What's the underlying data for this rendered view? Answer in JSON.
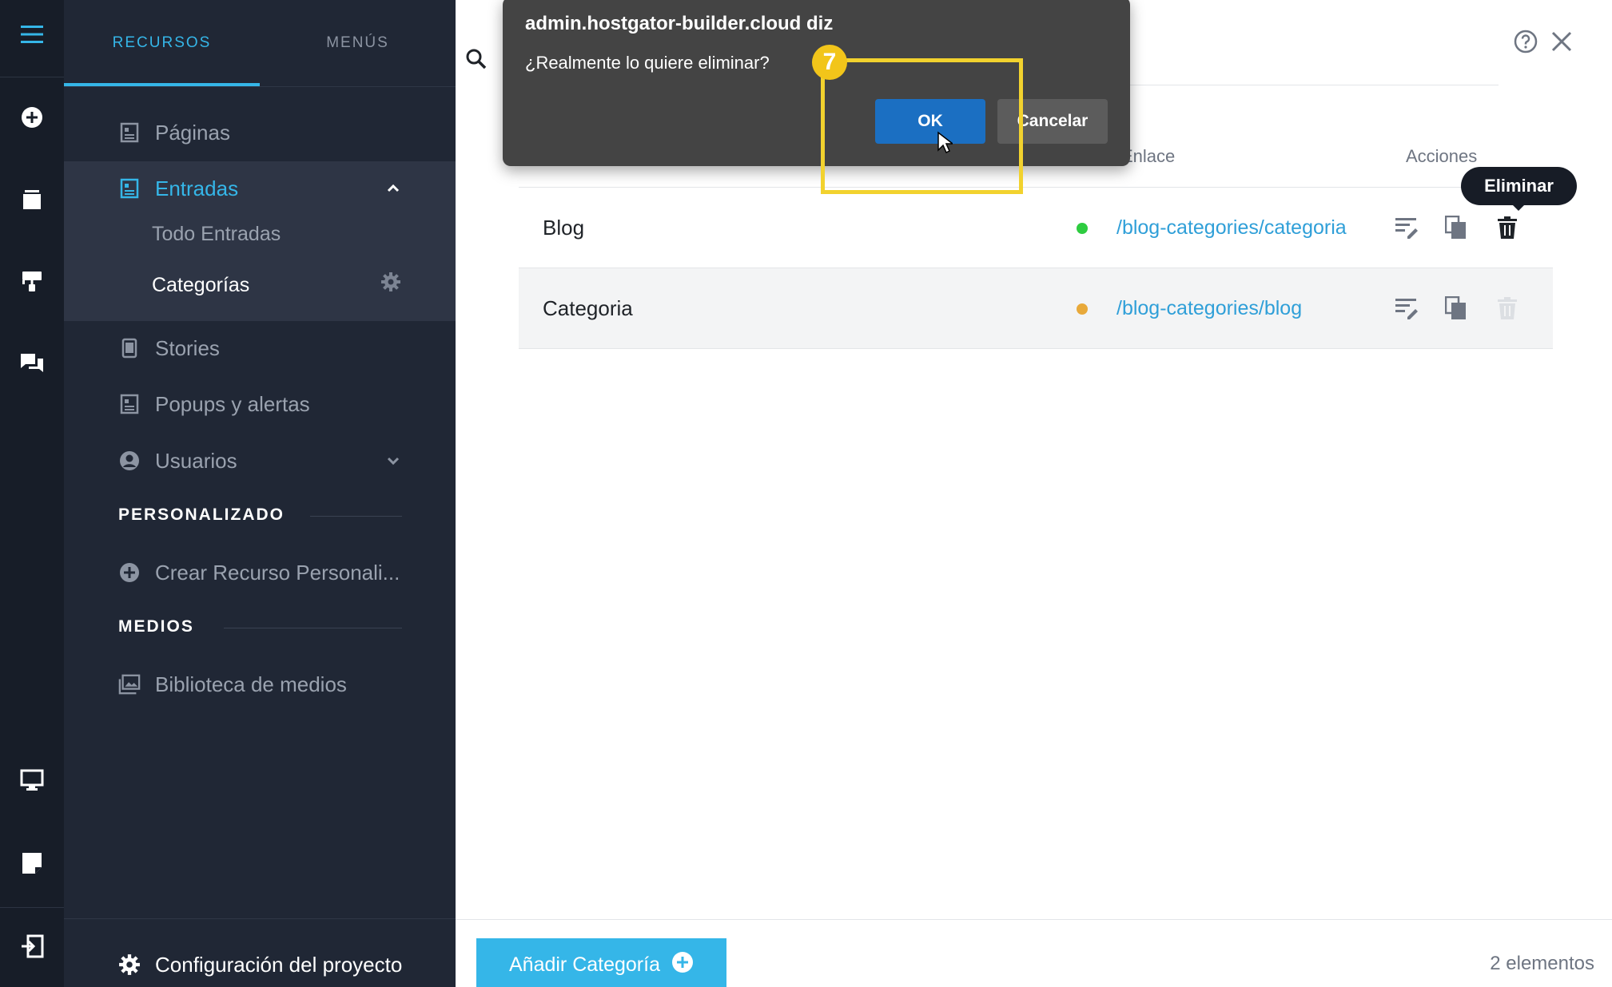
{
  "sidebar": {
    "tabs": [
      {
        "label": "RECURSOS",
        "active": true
      },
      {
        "label": "MENÚS",
        "active": false
      }
    ],
    "items": {
      "paginas": "Páginas",
      "entradas": "Entradas",
      "todo_entradas": "Todo Entradas",
      "categorias": "Categorías",
      "stories": "Stories",
      "popups": "Popups y alertas",
      "usuarios": "Usuarios",
      "crear_recurso": "Crear Recurso Personali...",
      "biblioteca": "Biblioteca de medios",
      "config": "Configuración del proyecto"
    },
    "sections": {
      "personalizado": "PERSONALIZADO",
      "medios": "MEDIOS"
    }
  },
  "table": {
    "headers": {
      "link": "Enlace",
      "actions": "Acciones"
    },
    "rows": [
      {
        "name": "Blog",
        "status_color": "#2ecc40",
        "link": "/blog-categories/categoria"
      },
      {
        "name": "Categoria",
        "status_color": "#e8a93a",
        "link": "/blog-categories/blog"
      }
    ]
  },
  "tooltip": {
    "label": "Eliminar"
  },
  "dialog": {
    "title": "admin.hostgator-builder.cloud diz",
    "message": "¿Realmente lo quiere eliminar?",
    "ok_label": "OK",
    "cancel_label": "Cancelar"
  },
  "step_badge": "7",
  "footer": {
    "add_label": "Añadir Categoría",
    "count": "2 elementos"
  },
  "colors": {
    "accent": "#35b6e8",
    "sidebar_bg": "#202735",
    "rail_bg": "#171d28",
    "highlight": "#f2d22e"
  }
}
